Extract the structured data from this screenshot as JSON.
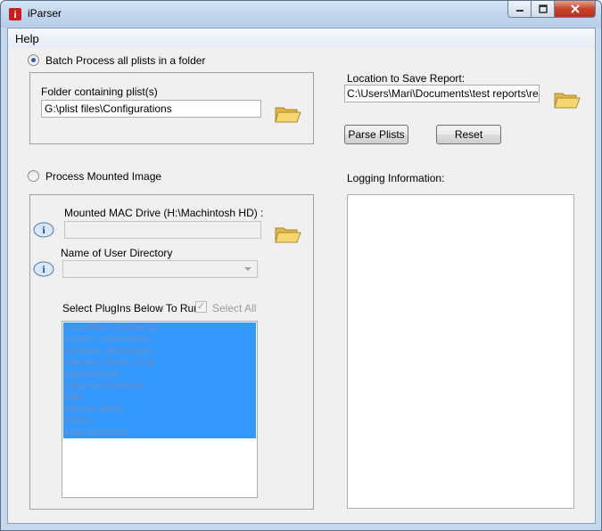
{
  "window": {
    "title": "iParser"
  },
  "menu": {
    "help": "Help"
  },
  "batch": {
    "radio_label": "Batch Process all plists in a folder",
    "folder_label": "Folder containing plist(s)",
    "folder_value": "G:\\plist files\\Configurations"
  },
  "mounted": {
    "radio_label": "Process Mounted Image",
    "drive_label": "Mounted MAC Drive (H:\\Machintosh HD) :",
    "drive_value": "",
    "user_dir_label": "Name of User Directory",
    "user_dir_value": "",
    "plugins_label": "Select PlugIns Below To Run:",
    "select_all_label": "Select All",
    "select_all_checked": true,
    "plugins": [
      "Initial Data Gathering",
      "System Information",
      "Network Information",
      "Internet, Email, Chat",
      "Applications",
      "Attached iDevices",
      "Mail",
      "Recent Items",
      "Safari",
      "User Accounts"
    ]
  },
  "report": {
    "location_label": "Location to Save Report:",
    "location_value": "C:\\Users\\Mari\\Documents\\test reports\\report",
    "parse_button": "Parse Plists",
    "reset_button": "Reset",
    "logging_label": "Logging Information:"
  },
  "colors": {
    "selection": "#3399ff",
    "titlebar": "#c5d8ee",
    "form_bg": "#f0f0f0"
  },
  "icons": [
    "app-icon",
    "folder-icon",
    "info-icon",
    "minimize-icon",
    "maximize-icon",
    "close-icon"
  ]
}
